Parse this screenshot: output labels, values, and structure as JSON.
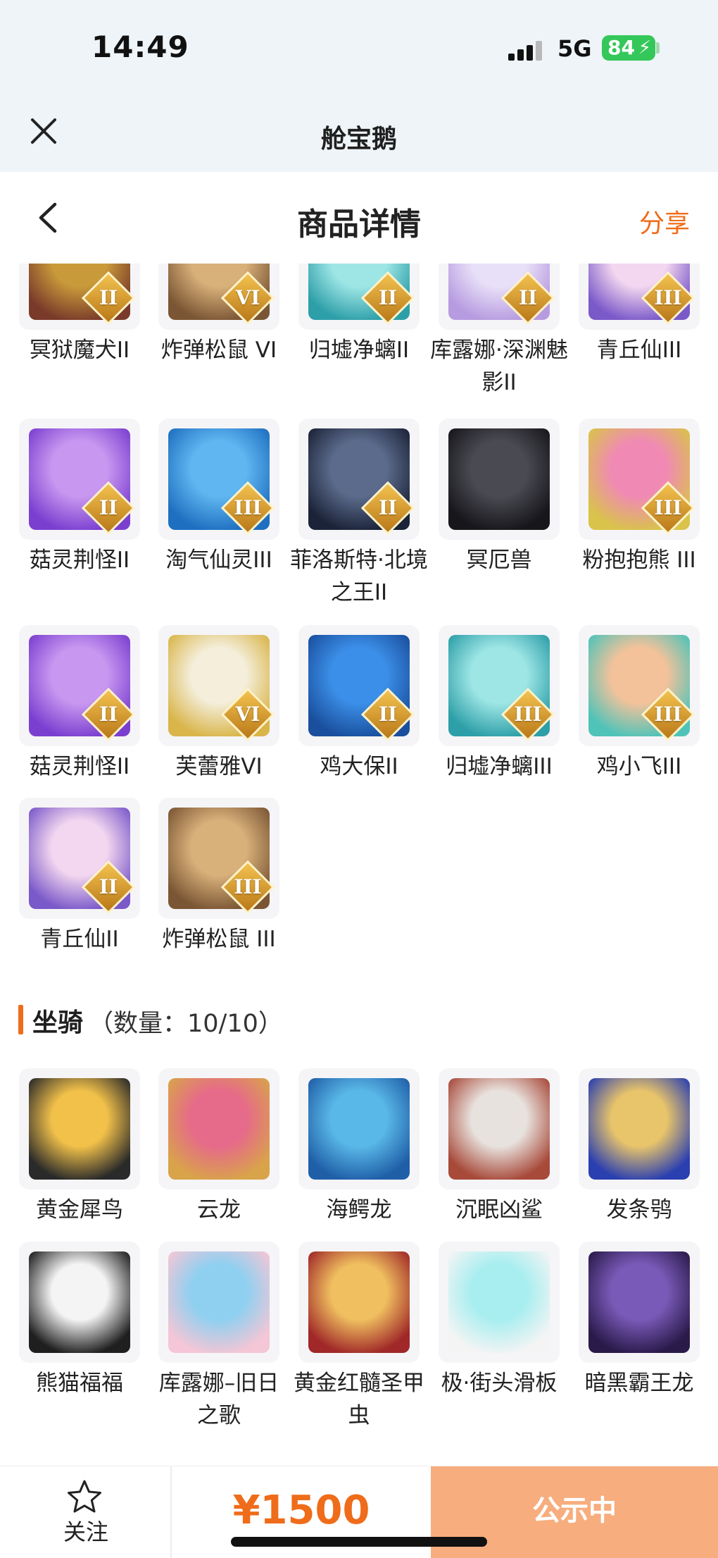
{
  "status_bar": {
    "time": "14:49",
    "network": "5G",
    "battery": "84"
  },
  "app_header": {
    "title": "舱宝鹅"
  },
  "page_nav": {
    "title": "商品详情",
    "share": "分享"
  },
  "pets": [
    {
      "name": "冥狱魔犬II",
      "badge": "II",
      "art": [
        "#c89a3a",
        "#7a3a2a"
      ]
    },
    {
      "name": "炸弹松鼠 VI",
      "badge": "VI",
      "art": [
        "#d8b07a",
        "#7b5634"
      ]
    },
    {
      "name": "归墟净螭II",
      "badge": "II",
      "art": [
        "#9ee6e6",
        "#2d9fa8"
      ]
    },
    {
      "name": "库露娜·深渊魅影II",
      "badge": "II",
      "art": [
        "#e8e0f8",
        "#b79be0"
      ]
    },
    {
      "name": "青丘仙III",
      "badge": "III",
      "art": [
        "#f3d6ef",
        "#7a59c9"
      ]
    },
    {
      "name": "菇灵荆怪II",
      "badge": "II",
      "art": [
        "#c898f0",
        "#7b3fd0"
      ]
    },
    {
      "name": "淘气仙灵III",
      "badge": "III",
      "art": [
        "#5fb6f0",
        "#1e6fc0"
      ]
    },
    {
      "name": "菲洛斯特·北境之王II",
      "badge": "II",
      "art": [
        "#5c6b8c",
        "#1b2338"
      ]
    },
    {
      "name": "冥厄兽",
      "badge": "",
      "art": [
        "#4a4a52",
        "#16161b"
      ]
    },
    {
      "name": "粉抱抱熊 III",
      "badge": "III",
      "art": [
        "#f08ab4",
        "#d9c34a"
      ]
    },
    {
      "name": "菇灵荆怪II",
      "badge": "II",
      "art": [
        "#c898f0",
        "#7b3fd0"
      ]
    },
    {
      "name": "芙蕾雅VI",
      "badge": "VI",
      "art": [
        "#f4eeda",
        "#d9b54a"
      ]
    },
    {
      "name": "鸡大保II",
      "badge": "II",
      "art": [
        "#3b8fe8",
        "#1a4f9e"
      ]
    },
    {
      "name": "归墟净螭III",
      "badge": "III",
      "art": [
        "#9ee6e6",
        "#2d9fa8"
      ]
    },
    {
      "name": "鸡小飞III",
      "badge": "III",
      "art": [
        "#f4c29a",
        "#4fc3b8"
      ]
    },
    {
      "name": "青丘仙II",
      "badge": "II",
      "art": [
        "#f3d6ef",
        "#7a59c9"
      ]
    },
    {
      "name": "炸弹松鼠 III",
      "badge": "III",
      "art": [
        "#d8b07a",
        "#7b5634"
      ]
    }
  ],
  "mounts_section": {
    "title": "坐骑",
    "count": "（数量：10/10）"
  },
  "mounts": [
    {
      "name": "黄金犀鸟",
      "art": [
        "#f2c14a",
        "#2a2a2a"
      ]
    },
    {
      "name": "云龙",
      "art": [
        "#e66a8a",
        "#d9a34a"
      ]
    },
    {
      "name": "海鳄龙",
      "art": [
        "#5ab8e8",
        "#1f5fa8"
      ]
    },
    {
      "name": "沉眠凶鲨",
      "art": [
        "#e8e2de",
        "#a84a3a"
      ]
    },
    {
      "name": "发条鸮",
      "art": [
        "#e8c46a",
        "#2a3fb0"
      ]
    },
    {
      "name": "熊猫福福",
      "art": [
        "#f4f4f4",
        "#1f1f1f"
      ]
    },
    {
      "name": "库露娜–旧日之歌",
      "art": [
        "#8fd0f0",
        "#f4c6d6"
      ]
    },
    {
      "name": "黄金红髓圣甲虫",
      "art": [
        "#f0c060",
        "#a02828"
      ]
    },
    {
      "name": "极·街头滑板",
      "art": [
        "#a8eef0",
        "#f4f4f4"
      ]
    },
    {
      "name": "暗黑霸王龙",
      "art": [
        "#7a5ab8",
        "#2a1a4a"
      ]
    }
  ],
  "bottom_bar": {
    "follow": "关注",
    "price": "¥1500",
    "status": "公示中"
  },
  "colors": {
    "accent": "#ef6c1a",
    "status_button": "#f7ad7e",
    "battery": "#34c759"
  }
}
